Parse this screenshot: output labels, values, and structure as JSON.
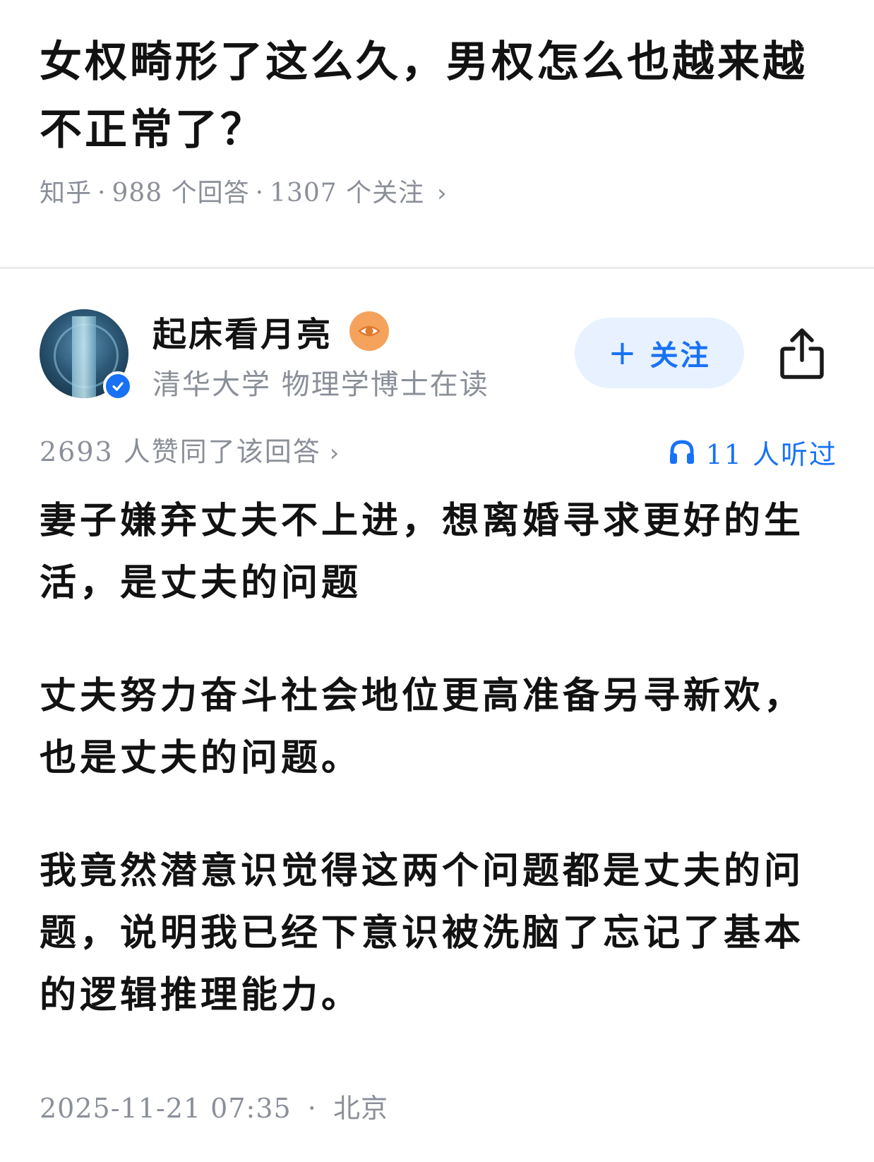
{
  "question": {
    "title": "女权畸形了这么久，男权怎么也越来越不正常了？",
    "source": "知乎",
    "answer_count": "988 个回答",
    "follower_count": "1307 个关注",
    "separator": "·"
  },
  "author": {
    "name": "起床看月亮",
    "bio": "清华大学 物理学博士在读",
    "follow_label": "关注",
    "icons": {
      "avatar": "avatar-image",
      "verified": "verified-check-icon",
      "badge": "eye-badge-icon",
      "share": "share-icon"
    }
  },
  "stats": {
    "upvotes_text": "2693 人赞同了该回答",
    "listened_text": "11 人听过"
  },
  "answer": {
    "paragraphs": [
      "妻子嫌弃丈夫不上进，想离婚寻求更好的生活，是丈夫的问题",
      "丈夫努力奋斗社会地位更高准备另寻新欢，也是丈夫的问题。",
      "我竟然潜意识觉得这两个问题都是丈夫的问题，说明我已经下意识被洗脑了忘记了基本的逻辑推理能力。"
    ]
  },
  "footer": {
    "datetime": "2025-11-21 07:35",
    "location": "北京",
    "separator": "·"
  },
  "colors": {
    "accent": "#1772f6",
    "muted": "#8a8f99",
    "follow_bg": "#e8f1ff",
    "badge": "#f5a25d"
  }
}
